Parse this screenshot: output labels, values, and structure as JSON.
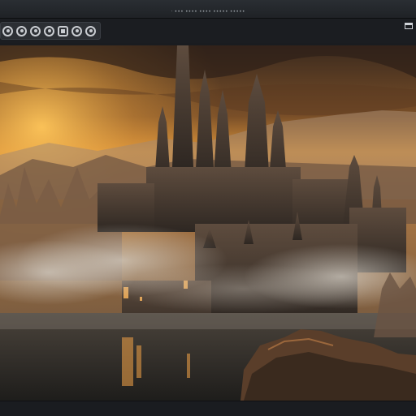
{
  "window": {
    "title": "· ••• •••• •••• ••••• •••••"
  },
  "toolbar": {
    "tools": [
      {
        "icon": "undo-icon"
      },
      {
        "icon": "redo-icon"
      },
      {
        "icon": "rotate-left-icon"
      },
      {
        "icon": "rotate-right-icon"
      },
      {
        "icon": "crop-icon"
      },
      {
        "icon": "zoom-out-icon"
      },
      {
        "icon": "zoom-in-icon"
      }
    ],
    "panel_icon": "panel-toggle-icon"
  },
  "canvas": {
    "image_subject": "castle-landscape"
  },
  "colors": {
    "sky_top": "#3b2a1e",
    "sky_glow": "#f0a23a",
    "castle": "#4a3a30",
    "fog": "#b8b2aa",
    "water": "#2a2824"
  },
  "status": {
    "text": ""
  }
}
